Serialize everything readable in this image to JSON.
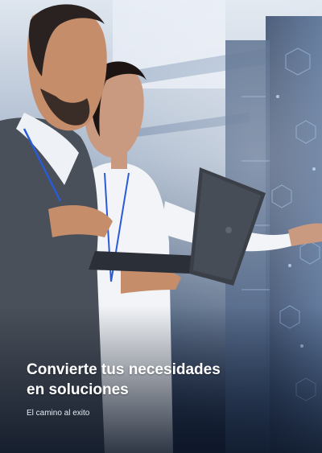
{
  "hero": {
    "headline_line1": "Convierte tus necesidades",
    "headline_line2": "en soluciones",
    "subtitle": "El camino al exito"
  }
}
